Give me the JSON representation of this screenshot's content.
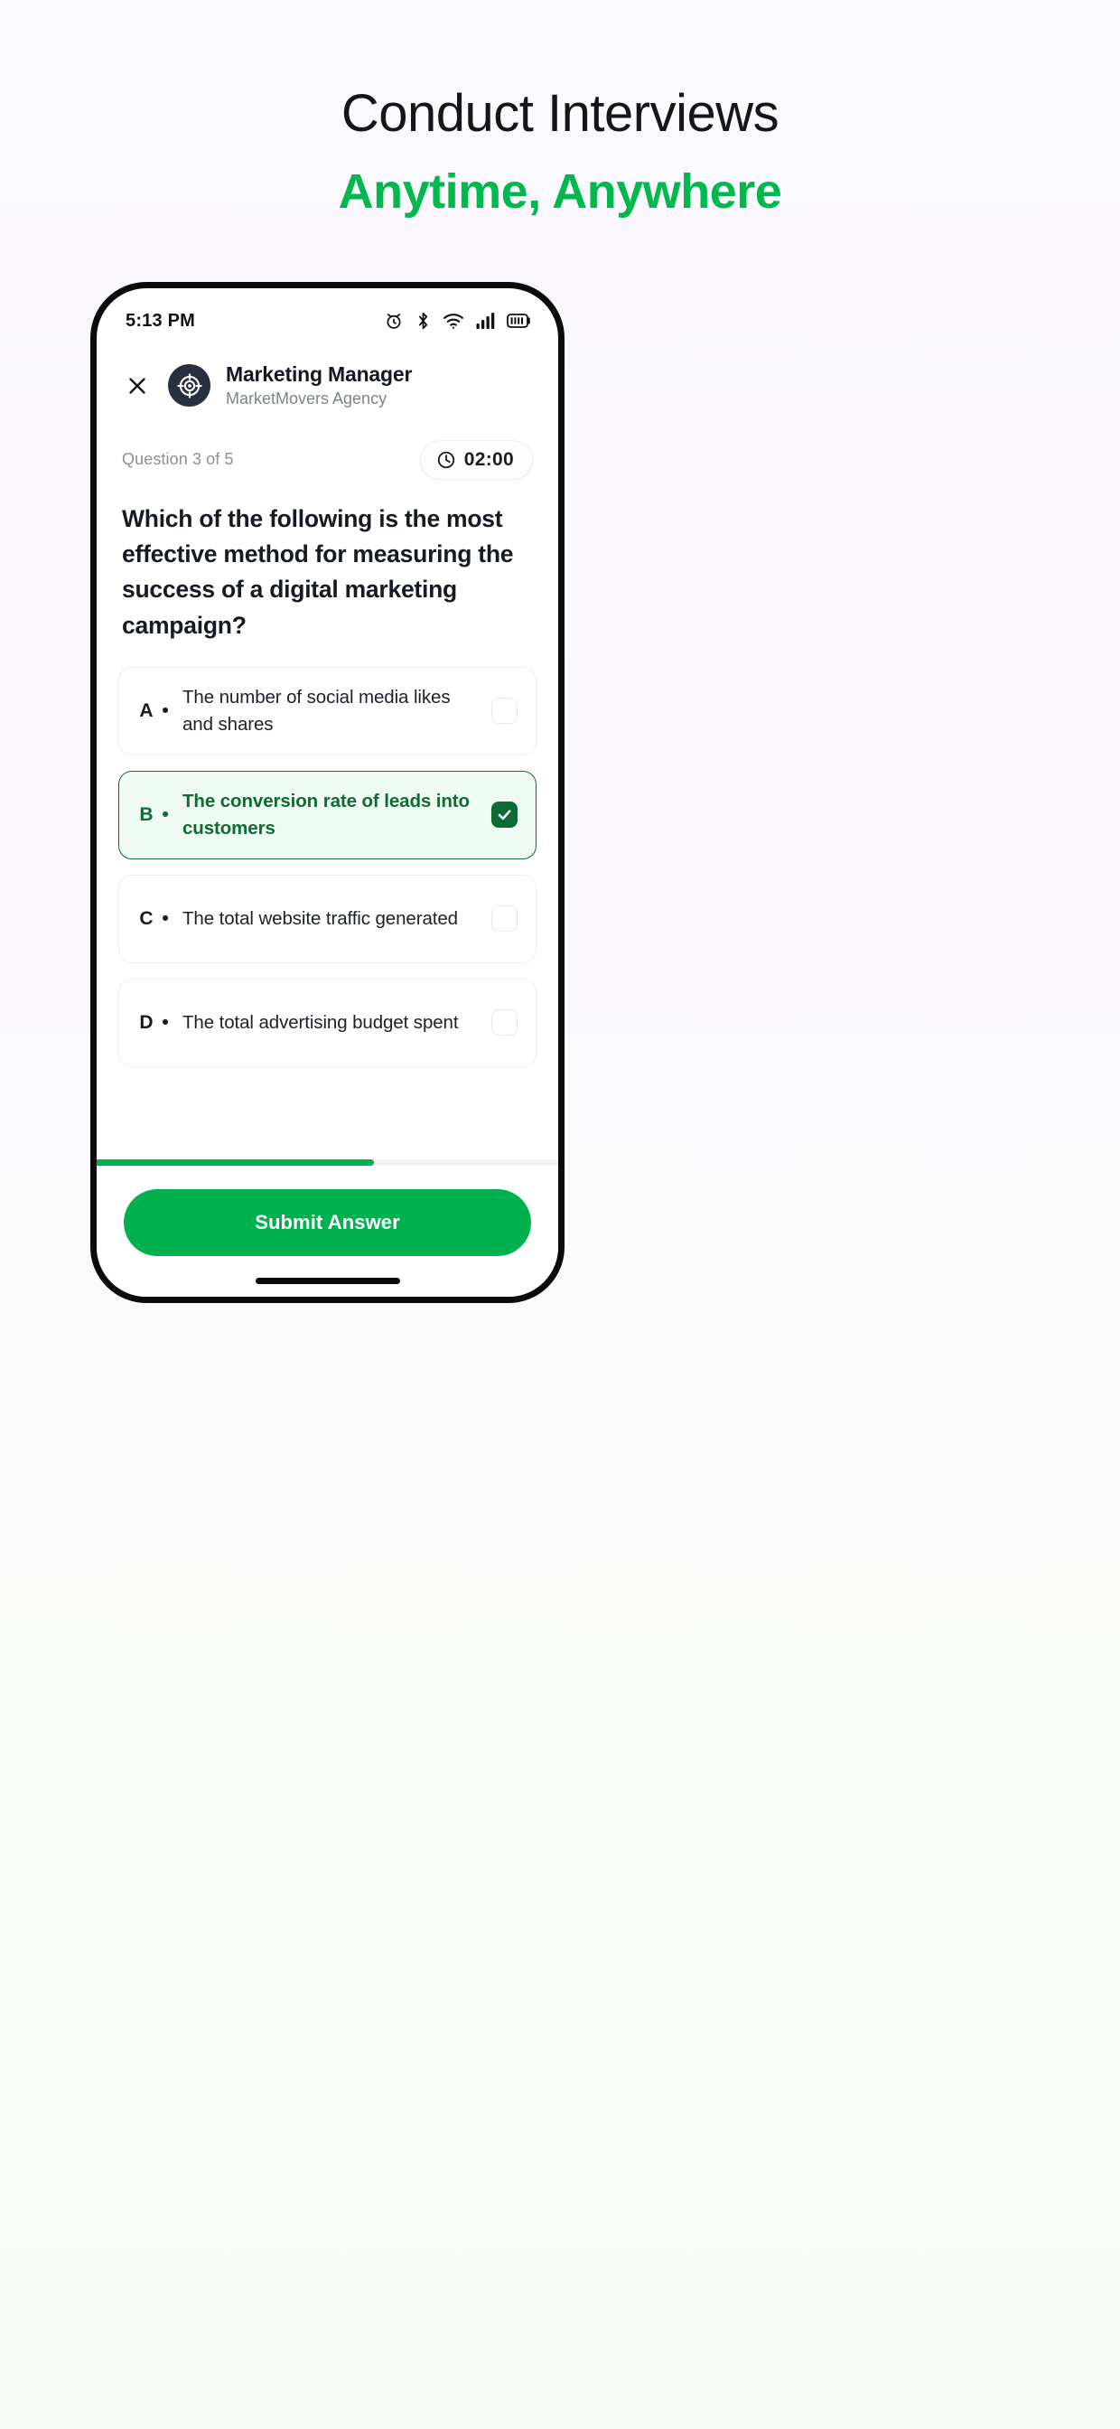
{
  "marketing": {
    "headline_line1": "Conduct Interviews",
    "headline_line2": "Anytime, Anywhere",
    "accent_color": "#00b84e"
  },
  "status_bar": {
    "time": "5:13 PM",
    "icons": [
      "alarm-icon",
      "bluetooth-icon",
      "wifi-icon",
      "cellular-signal-icon",
      "battery-icon"
    ]
  },
  "app_header": {
    "close_label": "✕",
    "avatar_icon": "target-crosshair-icon",
    "job_title": "Marketing Manager",
    "company": "MarketMovers Agency"
  },
  "question_meta": {
    "counter": "Question 3 of 5",
    "timer": "02:00",
    "timer_icon": "clock-icon"
  },
  "question": {
    "text": "Which of the following is the most effective method for measuring the success of a digital marketing campaign?"
  },
  "options": [
    {
      "letter": "A",
      "separator": "•",
      "text": "The number of social media likes and shares",
      "selected": false
    },
    {
      "letter": "B",
      "separator": "•",
      "text": "The conversion rate of leads into customers",
      "selected": true
    },
    {
      "letter": "C",
      "separator": "•",
      "text": "The total website traffic generated",
      "selected": false
    },
    {
      "letter": "D",
      "separator": "•",
      "text": "The total advertising budget spent",
      "selected": false
    }
  ],
  "progress": {
    "percent": 60,
    "fill_color": "#00b14f",
    "track_color": "#f2f3f4"
  },
  "footer": {
    "submit_label": "Submit Answer",
    "submit_color": "#00b14f"
  },
  "theme": {
    "selected_green": "#0d6b33",
    "selected_bg": "#effaf2",
    "avatar_navy": "#27303f"
  }
}
